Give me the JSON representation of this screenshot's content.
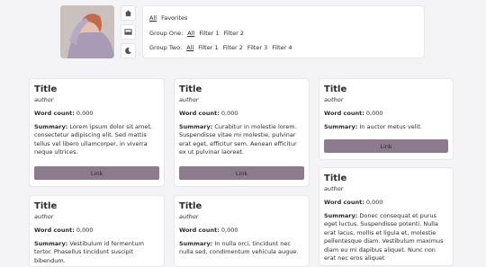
{
  "filters": {
    "top_row": [
      "All",
      "Favorites"
    ],
    "group_one": {
      "label": "Group One:",
      "options": [
        "All",
        "Filter 1",
        "Filter 2"
      ]
    },
    "group_two": {
      "label": "Group Two:",
      "options": [
        "All",
        "Filter 1",
        "Filter 2",
        "Filter 3",
        "Filter 4"
      ]
    }
  },
  "side_buttons": [
    "home-icon",
    "inbox-icon",
    "moon-icon"
  ],
  "cards": [
    {
      "title": "Title",
      "author": "author",
      "word_label": "Word count:",
      "word_value": "0,000",
      "summary_label": "Summary:",
      "summary": "Lorem ipsum dolor sit amet, consectetur adipiscing elit. Sed mattis tellus vel libero ullamcorper, in viverra neque ultrices.",
      "link": "Link"
    },
    {
      "title": "Title",
      "author": "author",
      "word_label": "Word count:",
      "word_value": "0,000",
      "summary_label": "Summary:",
      "summary": "Curabitur in molestie lorem. Suspendisse vitae mi molestie, pulvinar erat eget, efficitur sem. Aenean efficitur ex ut pulvinar laoreet.",
      "link": "Link"
    },
    {
      "title": "Title",
      "author": "author",
      "word_label": "Word count:",
      "word_value": "0,000",
      "summary_label": "Summary:",
      "summary": "In auctor metus velit.",
      "link": "Link"
    },
    {
      "title": "Title",
      "author": "author",
      "word_label": "Word count:",
      "word_value": "0,000",
      "summary_label": "Summary:",
      "summary": "Vestibulum id fermentum tortor. Phasellus tincidunt suscipit bibendum."
    },
    {
      "title": "Title",
      "author": "author",
      "word_label": "Word count:",
      "word_value": "0,000",
      "summary_label": "Summary:",
      "summary": "In nulla orci, tincidunt nec nulla sed, condimentum vehicula augue."
    },
    {
      "title": "Title",
      "author": "author",
      "word_label": "Word count:",
      "word_value": "0,000",
      "summary_label": "Summary:",
      "summary": "Donec consequat et purus eget luctus. Suspendisse potenti. Nulla erat lacus, mollis et ligula et, molestie pellentesque diam. Vestibulum maximus diam eu mi dapibus aliquet. Nunc non erat nec eros aliquet"
    }
  ],
  "colors": {
    "link_bg": "#8c7b8d",
    "page_bg": "#f4f4f6"
  }
}
